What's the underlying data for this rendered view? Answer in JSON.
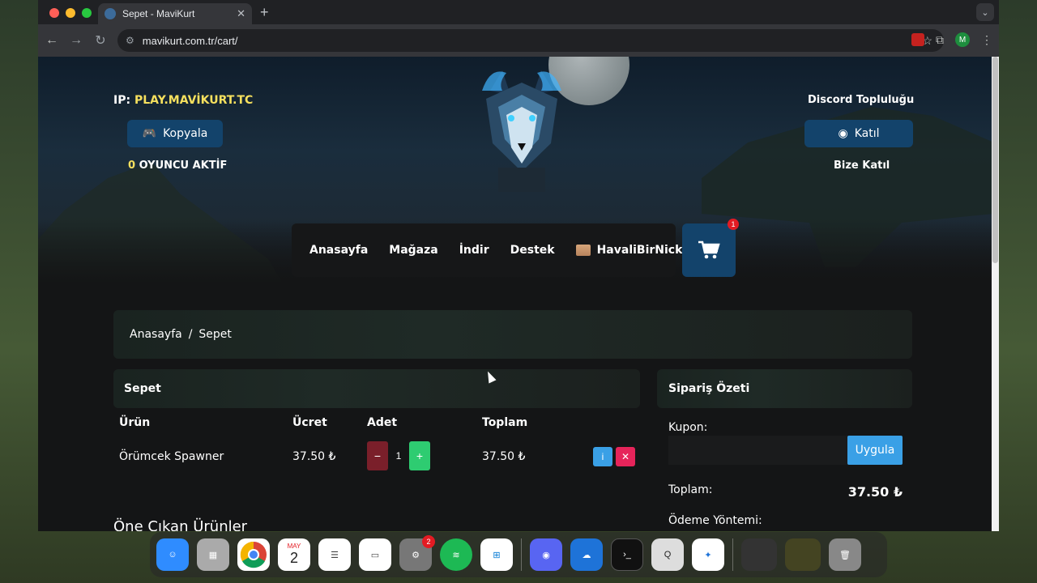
{
  "browser": {
    "tab_title": "Sepet - MaviKurt",
    "url": "mavikurt.com.tr/cart/"
  },
  "header": {
    "ip_prefix": "IP:",
    "ip_value": "PLAY.MAVİKURT.TC",
    "copy_label": "Kopyala",
    "players_count": "0",
    "players_label": "OYUNCU AKTİF",
    "discord_title": "Discord Topluluğu",
    "discord_button": "Katıl",
    "discord_sub": "Bize Katıl"
  },
  "nav": {
    "items": [
      "Anasayfa",
      "Mağaza",
      "İndir",
      "Destek"
    ],
    "user": "HavaliBirNick",
    "cart_count": "1"
  },
  "breadcrumb": {
    "home": "Anasayfa",
    "sep": "/",
    "current": "Sepet"
  },
  "cart": {
    "title": "Sepet",
    "headers": {
      "product": "Ürün",
      "price": "Ücret",
      "qty": "Adet",
      "total": "Toplam"
    },
    "items": [
      {
        "name": "Örümcek Spawner",
        "price": "37.50 ₺",
        "qty": "1",
        "total": "37.50 ₺"
      }
    ]
  },
  "summary": {
    "title": "Sipariş Özeti",
    "coupon_label": "Kupon:",
    "apply": "Uygula",
    "total_label": "Toplam:",
    "total_value": "37.50 ₺",
    "payment_label": "Ödeme Yöntemi:"
  },
  "featured_title": "Öne Çıkan Ürünler",
  "dock": {
    "calendar_month": "MAY",
    "calendar_day": "2",
    "settings_badge": "2"
  },
  "colors": {
    "accent_blue": "#13436b",
    "highlight_yellow": "#f6e05e",
    "apply_blue": "#3aa0e6"
  }
}
